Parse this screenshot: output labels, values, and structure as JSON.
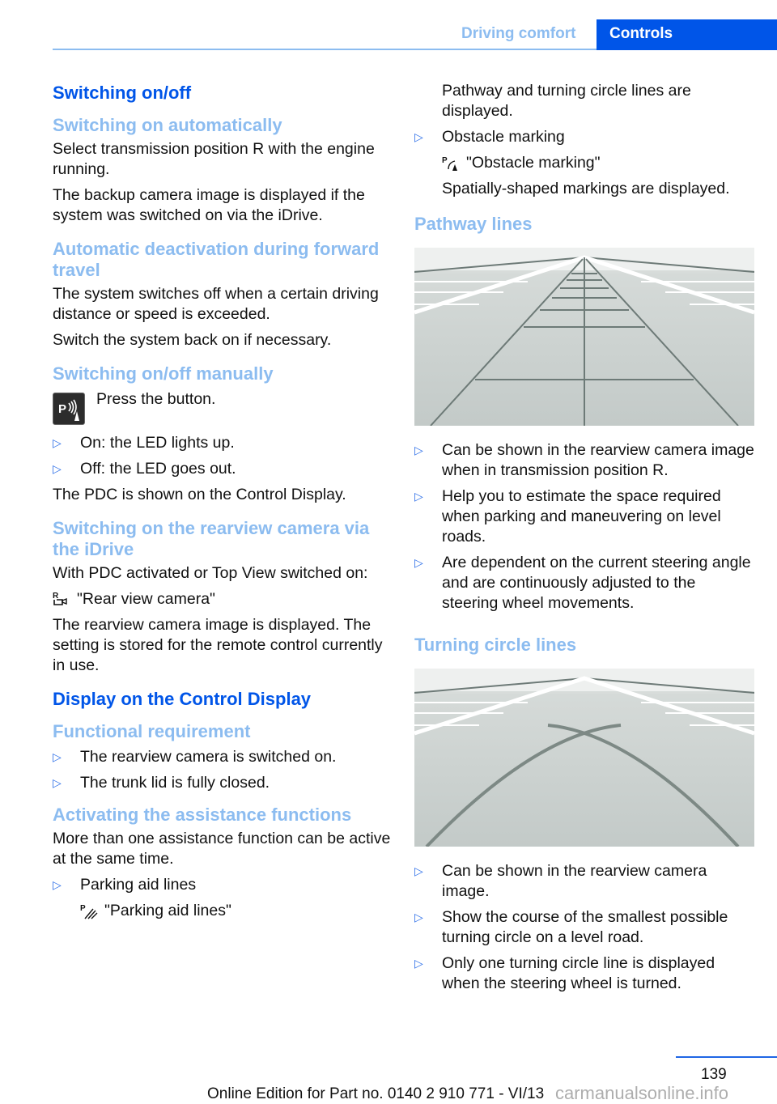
{
  "header": {
    "section": "Driving comfort",
    "tab": "Controls"
  },
  "colors": {
    "heading_primary": "#0055e8",
    "heading_secondary": "#8cbcf0",
    "bullet": "#2a6de8"
  },
  "left": {
    "h_switching": "Switching on/off",
    "h_auto": "Switching on automatically",
    "p_auto1": "Select transmission position R with the engine running.",
    "p_auto2": "The backup camera image is displayed if the system was switched on via the iDrive.",
    "h_deact": "Automatic deactivation during forward travel",
    "p_deact1": "The system switches off when a certain driving distance or speed is exceeded.",
    "p_deact2": "Switch the system back on if necessary.",
    "h_manual": "Switching on/off manually",
    "press_button": "Press the button.",
    "manual_items": [
      "On: the LED lights up.",
      "Off: the LED goes out."
    ],
    "p_pdc": "The PDC is shown on the Control Display.",
    "h_idrive": "Switching on the rearview camera via the iDrive",
    "p_idrive1": "With PDC activated or Top View switched on:",
    "rear_view_label": "\"Rear view camera\"",
    "p_idrive2": "The rearview camera image is displayed. The setting is stored for the remote control currently in use.",
    "h_display": "Display on the Control Display",
    "h_func": "Functional requirement",
    "func_items": [
      "The rearview camera is switched on.",
      "The trunk lid is fully closed."
    ],
    "h_assist": "Activating the assistance functions",
    "p_assist": "More than one assistance function can be active at the same time.",
    "assist_item1": "Parking aid lines",
    "parking_aid_label": "\"Parking aid lines\""
  },
  "right": {
    "p_pathway_turning": "Pathway and turning circle lines are displayed.",
    "assist_item2": "Obstacle marking",
    "obstacle_label": "\"Obstacle marking\"",
    "p_spatial": "Spatially-shaped markings are displayed.",
    "h_pathway": "Pathway lines",
    "pathway_items": [
      "Can be shown in the rearview camera image when in transmission position R.",
      "Help you to estimate the space required when parking and maneuvering on level roads.",
      "Are dependent on the current steering angle and are continuously adjusted to the steering wheel movements."
    ],
    "h_turning": "Turning circle lines",
    "turning_items": [
      "Can be shown in the rearview camera image.",
      "Show the course of the smallest possible turning circle on a level road.",
      "Only one turning circle line is displayed when the steering wheel is turned."
    ]
  },
  "footer": {
    "page_number": "139",
    "edition": "Online Edition for Part no. 0140 2 910 771 - VI/13",
    "watermark": "carmanualsonline.info"
  }
}
